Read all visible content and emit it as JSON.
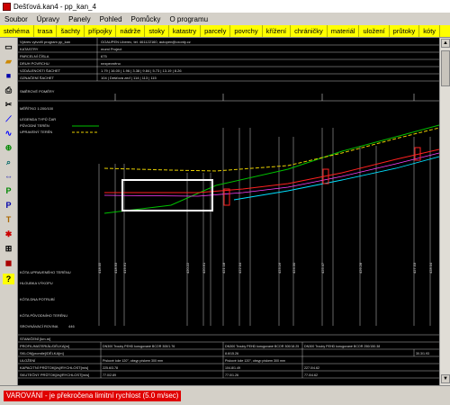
{
  "window": {
    "title": "Dešťová.kan4 - pp_kan_4"
  },
  "menu": {
    "items": [
      "Soubor",
      "Úpravy",
      "Panely",
      "Pohled",
      "Pomůcky",
      "O programu"
    ]
  },
  "tabs": {
    "items": [
      "stehéma",
      "trasa",
      "šachty",
      "přípojky",
      "nádrže",
      "stoky",
      "katastry",
      "parcely",
      "povrchy",
      "křížení",
      "chráničky",
      "materiál",
      "uložení",
      "průtoky",
      "kóty"
    ]
  },
  "header_table": {
    "rows": [
      {
        "label": "Výkres vytvořil program pp_kan",
        "value": "GOAUPEN Liberec, tel. 461122160, autopen@cxonty.cz"
      },
      {
        "label": "KATASTRY",
        "value": "moml Project"
      },
      {
        "label": "PARCELNÍ ČÍSLA",
        "value": "675"
      },
      {
        "label": "DRUH POVRCHU",
        "value": "nezpevněno"
      },
      {
        "label": "VZDÁLENOSTI ŠACHET",
        "value": "1.79 | 16.00 | 1.96 | 3.38 | 9.84 | 5.73 | 13.19 | 8.26"
      },
      {
        "label": "OZNAČENÍ ŠACHET",
        "value": "104 | Dešťová zeď | 114 | 113 | 115"
      }
    ]
  },
  "left_labels": {
    "smerove": "SMĚROVÉ POMĚRY",
    "meritko": "MĚŘÍTKO 1:200/100",
    "legenda": "LEGENDA TYPŮ ČAR",
    "puvodni": "PŮVODNÍ TERÉN",
    "upraveny": "UPRAVENÝ TERÉN"
  },
  "bottom_labels": {
    "kota_upr": "KÓTA UPRAVENÉHO TERÉNU",
    "hloubka": "HLOUBKA VÝKOPU",
    "kota_dna": "KÓTA DNA POTRUBÍ",
    "kota_puv": "KÓTA PŮVODNÍHO TERÉNU",
    "srovnavaci": "SROVNÁVACÍ ROVINA",
    "srovnavaci_val": "446"
  },
  "bottom_table": {
    "rows": [
      {
        "label": "STANIČENÍ [km.m]",
        "cells": []
      },
      {
        "label": "PROFIL/MATERIÁL/DÉLKA[m]",
        "cells": [
          "DN300 Trouby PEHD korugované BCOR 300/1.76",
          "DN300 Trouby PEHD korugované BCOR 300/18.25",
          "DN300 Trouby PEHD korugované BCOR 250/150.38"
        ]
      },
      {
        "label": "SKLON[promile]/DÉLKA[m]",
        "cells": [
          "",
          "8.6/15.26",
          "",
          "30.3/1.93"
        ]
      },
      {
        "label": "ULOŽENÍ",
        "cells": [
          "Pískové lože 120°, obsyp pískem 300 mm",
          "Pískové lože 120°, obsyp pískem 300 mm"
        ]
      },
      {
        "label": "KAPACITNÍ PRŮTOK[l/s]/RYCHLOST[m/s]",
        "cells": [
          "225.6/3.78",
          "104.8/1.49",
          "227.0/4.62"
        ]
      },
      {
        "label": "SKUTEČNÝ PRŮTOK[l/s]/RYCHLOST[m/s]",
        "cells": [
          "77.0/2.89",
          "77.0/1.26",
          "77.0/4.62"
        ]
      }
    ]
  },
  "dimension_numbers": [
    "418.05",
    "418.93",
    "419.61",
    "420.22",
    "420.61",
    "421.18",
    "422.04",
    "423.16",
    "424.30",
    "425.47",
    "426.28",
    "427.53",
    "428.04"
  ],
  "status": {
    "warning": "VAROVÁNÍ - je překročena limitní rychlost (5.0 m/sec)"
  },
  "colors": {
    "tab_bg": "#ffff00",
    "canvas_bg": "#000000",
    "terrain_green": "#00c000",
    "terrain_yellow": "#e8d000",
    "pipe_red": "#ff2020",
    "pipe_cyan": "#00e0ff",
    "pipe_magenta": "#ff40ff",
    "warning_bg": "#e00000"
  }
}
